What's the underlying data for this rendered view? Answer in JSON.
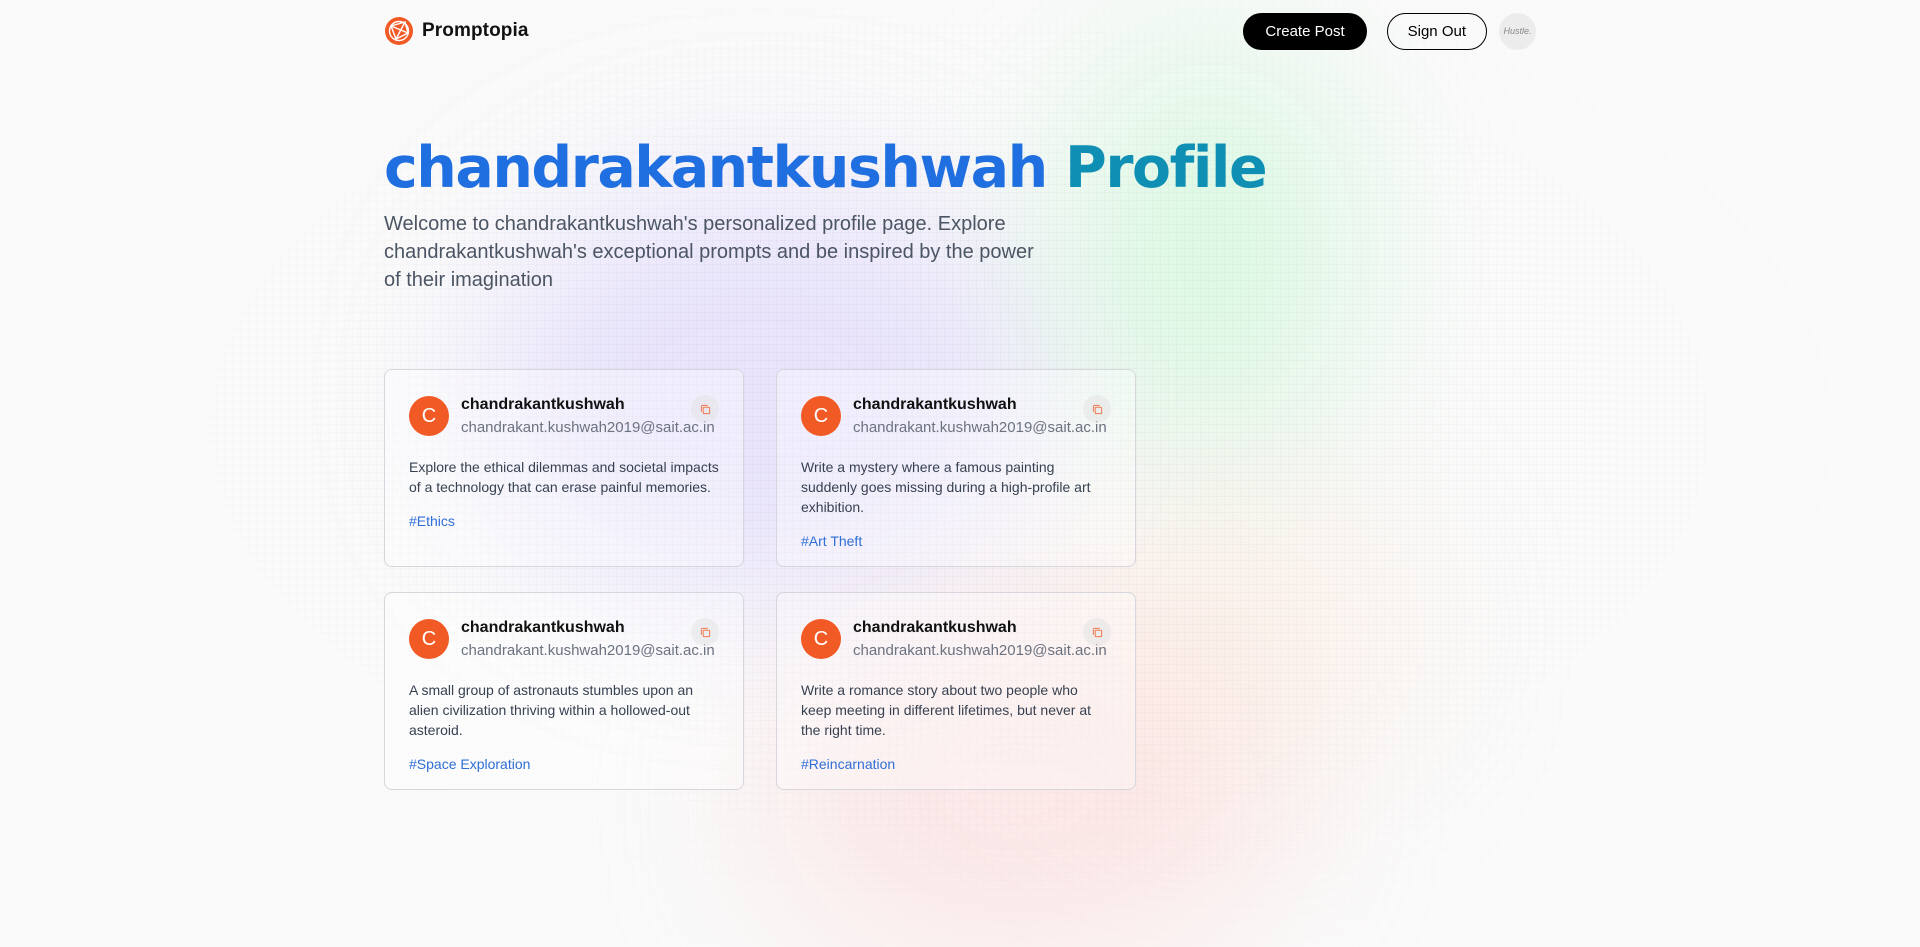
{
  "nav": {
    "brand": "Promptopia",
    "create_post_label": "Create Post",
    "sign_out_label": "Sign Out",
    "avatar_text": "Hustle."
  },
  "hero": {
    "name": "chandrakantkushwah",
    "title_suffix": "Profile",
    "description": "Welcome to chandrakantkushwah's personalized profile page. Explore chandrakantkushwah's exceptional prompts and be inspired by the power of their imagination"
  },
  "colors": {
    "avatar_orange": "#f25a25",
    "title_blue": "#1f6fe0",
    "title_cyan": "#0e8fb3",
    "tag_blue": "#2f6ed6"
  },
  "posts": [
    {
      "avatar_letter": "C",
      "username": "chandrakantkushwah",
      "email": "chandrakant.kushwah2019@sait.ac.in",
      "prompt": "Explore the ethical dilemmas and societal impacts of a technology that can erase painful memories.",
      "tag": "#Ethics",
      "copy_icon": "copy-icon"
    },
    {
      "avatar_letter": "C",
      "username": "chandrakantkushwah",
      "email": "chandrakant.kushwah2019@sait.ac.in",
      "prompt": "Write a mystery where a famous painting suddenly goes missing during a high-profile art exhibition.",
      "tag": "#Art Theft",
      "copy_icon": "copy-icon"
    },
    {
      "avatar_letter": "C",
      "username": "chandrakantkushwah",
      "email": "chandrakant.kushwah2019@sait.ac.in",
      "prompt": "A small group of astronauts stumbles upon an alien civilization thriving within a hollowed-out asteroid.",
      "tag": "#Space Exploration",
      "copy_icon": "copy-icon"
    },
    {
      "avatar_letter": "C",
      "username": "chandrakantkushwah",
      "email": "chandrakant.kushwah2019@sait.ac.in",
      "prompt": "Write a romance story about two people who keep meeting in different lifetimes, but never at the right time.",
      "tag": "#Reincarnation",
      "copy_icon": "copy-icon"
    }
  ]
}
